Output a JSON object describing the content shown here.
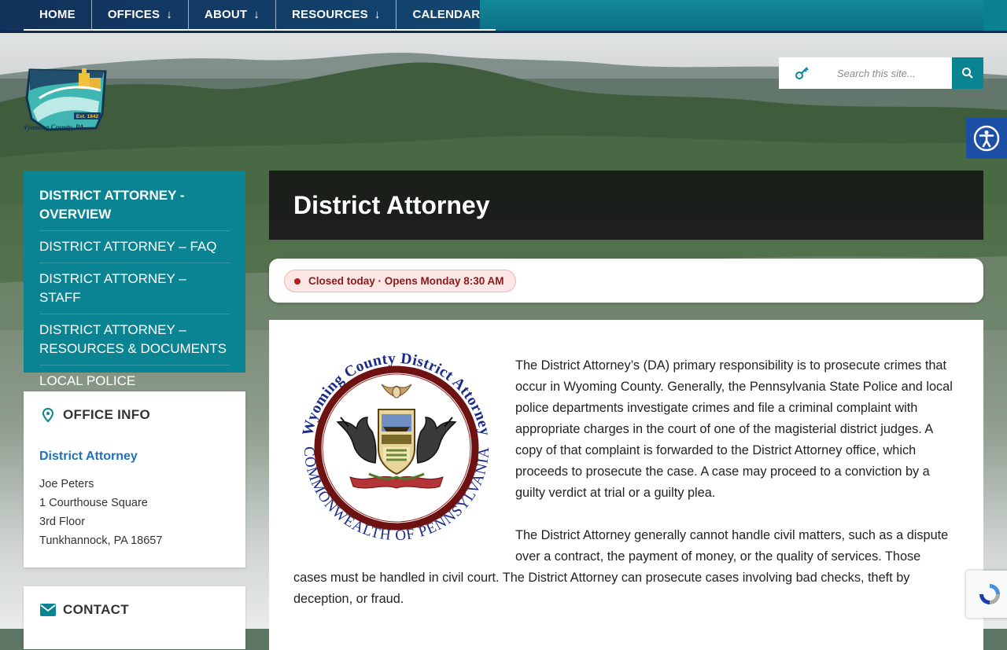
{
  "nav": {
    "items": [
      {
        "label": "HOME",
        "dropdown": false
      },
      {
        "label": "OFFICES",
        "dropdown": true
      },
      {
        "label": "ABOUT",
        "dropdown": true
      },
      {
        "label": "RESOURCES",
        "dropdown": true
      },
      {
        "label": "CALENDAR",
        "dropdown": false
      }
    ],
    "arrow": "↓"
  },
  "logo": {
    "text": "Wyoming County, PA",
    "est": "Est. 1842"
  },
  "search": {
    "placeholder": "Search this site..."
  },
  "sidebar": {
    "items": [
      {
        "label": "DISTRICT ATTORNEY - OVERVIEW",
        "active": true
      },
      {
        "label": "DISTRICT ATTORNEY – FAQ",
        "active": false
      },
      {
        "label": "DISTRICT ATTORNEY – STAFF",
        "active": false
      },
      {
        "label": "DISTRICT ATTORNEY – RESOURCES & DOCUMENTS",
        "active": false
      },
      {
        "label": "LOCAL POLICE DEPARTMENTS",
        "active": false
      }
    ]
  },
  "office_info": {
    "heading": "OFFICE INFO",
    "name": "District Attorney",
    "address": [
      "Joe Peters",
      "1 Courthouse Square",
      "3rd Floor",
      "Tunkhannock, PA 18657"
    ]
  },
  "contact": {
    "heading": "CONTACT"
  },
  "page": {
    "title": "District Attorney"
  },
  "status": {
    "text": "Closed today · Opens Monday 8:30 AM"
  },
  "seal": {
    "top_text": "Wyoming County District Attorney",
    "bottom_text": "COMMONWEALTH OF PENNSYLVANIA"
  },
  "content": {
    "paragraphs": [
      "The District Attorney’s (DA) primary responsibility is to prosecute crimes that occur in Wyoming County.  Generally, the Pennsylvania State Police and local police departments investigate crimes and file a criminal complaint with appropriate charges in the court of one of the magisterial district judges.  A copy of that complaint is forwarded to the District Attorney office, which proceeds to prosecute the case.  A case may proceed to a conviction by a guilty verdict at trial or a guilty plea.",
      "The District Attorney generally cannot handle civil matters, such as a dispute over a contract, the payment of money, or the quality of services. Those cases must be handled in civil court.  The District Attorney can prosecute cases involving bad checks, theft by deception, or fraud."
    ]
  },
  "colors": {
    "teal": "#0a8392",
    "navy": "#12315a",
    "link_blue": "#1f72b8",
    "status_red": "#8b1a1a",
    "seal_maroon": "#6e1111",
    "seal_blue": "#1a2a8c"
  },
  "icons": [
    "key-icon",
    "search-icon",
    "accessibility-icon",
    "map-pin-icon",
    "envelope-icon",
    "recaptcha-icon"
  ]
}
